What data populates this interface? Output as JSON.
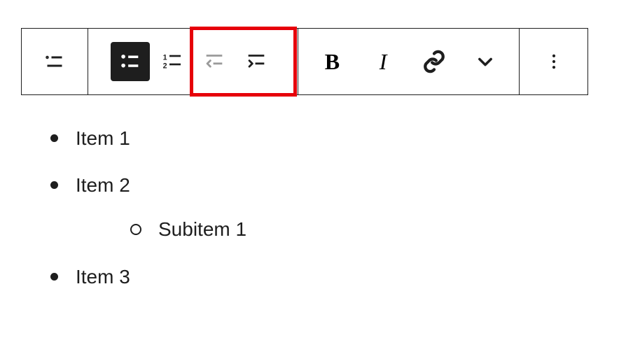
{
  "toolbar": {
    "blockType": "List block",
    "unordered": "Unordered list",
    "ordered": "Ordered list",
    "outdent": "Outdent",
    "indent": "Indent",
    "bold": "Bold",
    "italic": "Italic",
    "link": "Link",
    "more": "More rich text controls",
    "options": "Options"
  },
  "list": {
    "items": [
      {
        "text": "Item 1"
      },
      {
        "text": "Item 2",
        "children": [
          {
            "text": "Subitem 1"
          }
        ]
      },
      {
        "text": "Item 3"
      }
    ]
  }
}
